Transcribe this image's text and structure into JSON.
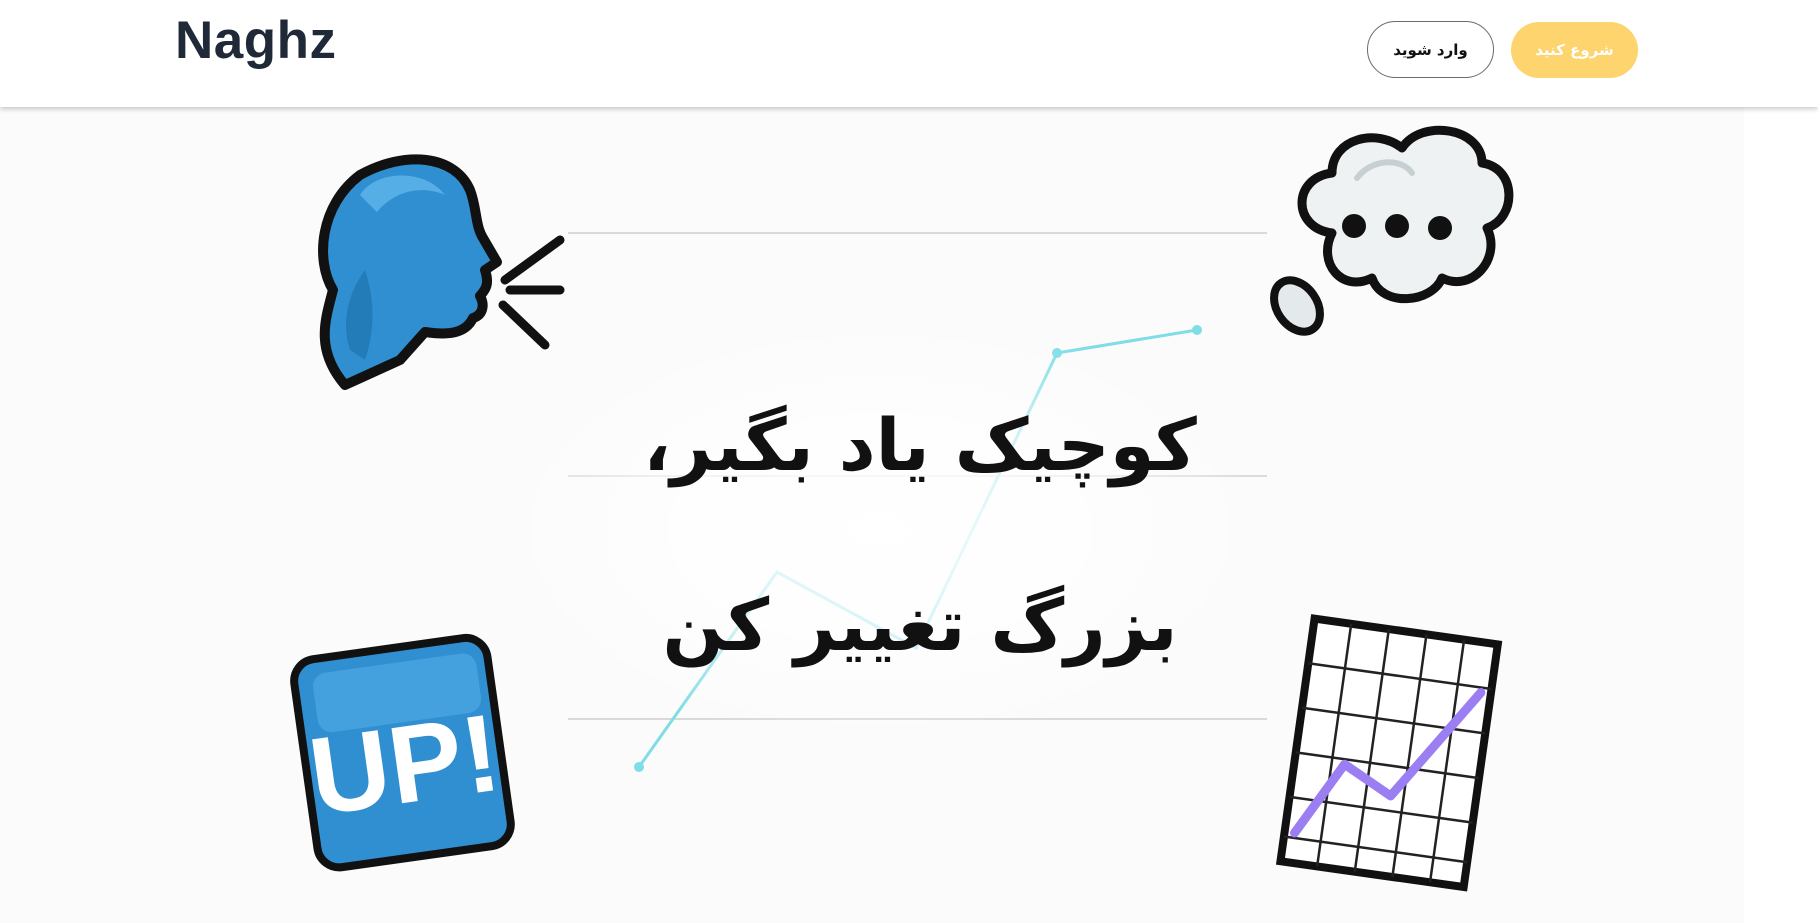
{
  "header": {
    "logo": "Naghz",
    "start_button": "شروع کنید",
    "login_button": "وارد شوید"
  },
  "hero": {
    "line1": "کوچیک یاد بگیر،",
    "line2": "بزرگ تغییر کن",
    "badge_text": "UP!"
  },
  "colors": {
    "accent": "#fdd46e",
    "logo": "#1f2937",
    "chart_line": "#7fdde6",
    "sticker_blue": "#2f8fd0",
    "graph_purple": "#9b7ff2"
  },
  "icons": [
    "speaking-head-icon",
    "thought-bubble-icon",
    "up-badge-icon",
    "chart-increasing-icon"
  ]
}
